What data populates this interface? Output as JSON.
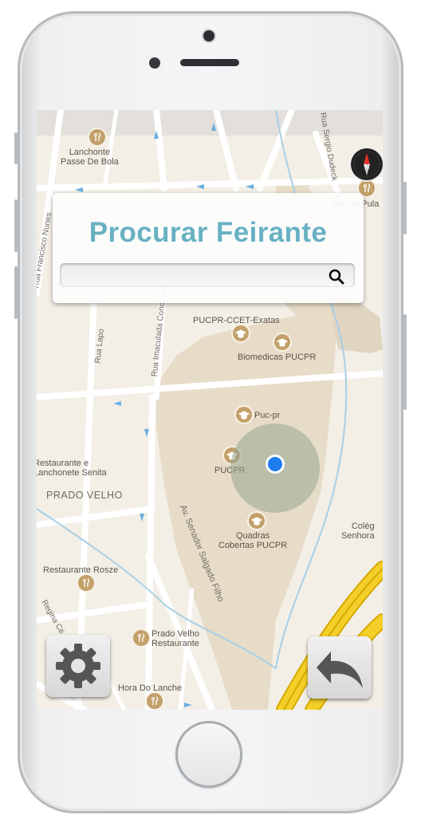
{
  "search": {
    "title": "Procurar Feirante",
    "placeholder": "",
    "value": ""
  },
  "map": {
    "districts": [
      "PRADO VELHO"
    ],
    "streets": [
      "Rua Francisco Nunes",
      "Rua Lapo",
      "Rua Imaculada Conceição",
      "Av. Senador Salgado Filho",
      "Rua Sergio Dudeck",
      "Regina Cé"
    ],
    "places": {
      "lanchonete_passe_de_bola": [
        "Lanchonte",
        "Passe De Bola"
      ],
      "bar_do_pula": "Bar Do Pula",
      "pucpr_ccet": "PUCPR-CCET-Exatas",
      "biomedicas": "Biomedicas PUCPR",
      "puc_pr": "Puc-pr",
      "pucpr": "PUCPR",
      "quadras": [
        "Quadras",
        "Cobertas PUCPR"
      ],
      "restaurante_senita": [
        "Restaurante e",
        "Lanchonete Senita"
      ],
      "restaurante_rosze": "Restaurante Rosze",
      "prado_velho_rest": [
        "Prado Velho",
        "Restaurante"
      ],
      "hora_do_lanche": "Hora Do Lanche",
      "colegio": [
        "Colég",
        "Senhora"
      ]
    },
    "compass_label": "N"
  },
  "colors": {
    "title": "#68b1c3",
    "user_location": "#1e7cf0",
    "campus": "#e7dcc8",
    "highway": "#f4cf2a"
  },
  "icons": {
    "settings": "gear-icon",
    "back": "undo-arrow-icon",
    "search": "magnifier-icon"
  }
}
